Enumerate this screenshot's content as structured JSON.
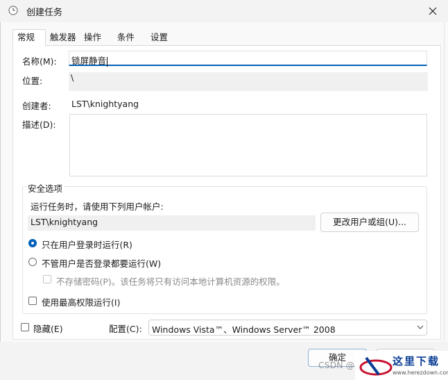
{
  "window": {
    "title": "创建任务"
  },
  "tabs": [
    {
      "label": "常规",
      "active": true
    },
    {
      "label": "触发器",
      "active": false
    },
    {
      "label": "操作",
      "active": false
    },
    {
      "label": "条件",
      "active": false
    },
    {
      "label": "设置",
      "active": false
    }
  ],
  "general": {
    "name_label": "名称(M):",
    "name_value": "锁屏静音",
    "location_label": "位置:",
    "location_value": "\\",
    "author_label": "创建者:",
    "author_value": "LST\\knightyang",
    "description_label": "描述(D):",
    "description_value": ""
  },
  "security": {
    "group_title": "安全选项",
    "run_as_prompt": "运行任务时，请使用下列用户帐户:",
    "user_account": "LST\\knightyang",
    "change_user_button": "更改用户或组(U)...",
    "option_logged_on": "只在用户登录时运行(R)",
    "option_logged_on_selected": true,
    "option_whether_logged": "不管用户是否登录都要运行(W)",
    "option_whether_logged_selected": false,
    "do_not_store_password": "不存储密码(P)。该任务将只有访问本地计算机资源的权限。",
    "highest_privileges": "使用最高权限运行(I)"
  },
  "footer": {
    "hidden_label": "隐藏(E)",
    "configure_label": "配置(C):",
    "configure_value": "Windows Vista™、Windows Server™ 2008",
    "ok_button": "确定"
  },
  "watermark": {
    "csdn_text": "CSDN @",
    "site_name": "这里下载",
    "site_url": "www.herezdown.com"
  },
  "colors": {
    "accent": "#005fb8",
    "window_bg": "#f9f9f9",
    "panel_bg": "#ffffff",
    "field_bg": "#f0f0f0"
  }
}
